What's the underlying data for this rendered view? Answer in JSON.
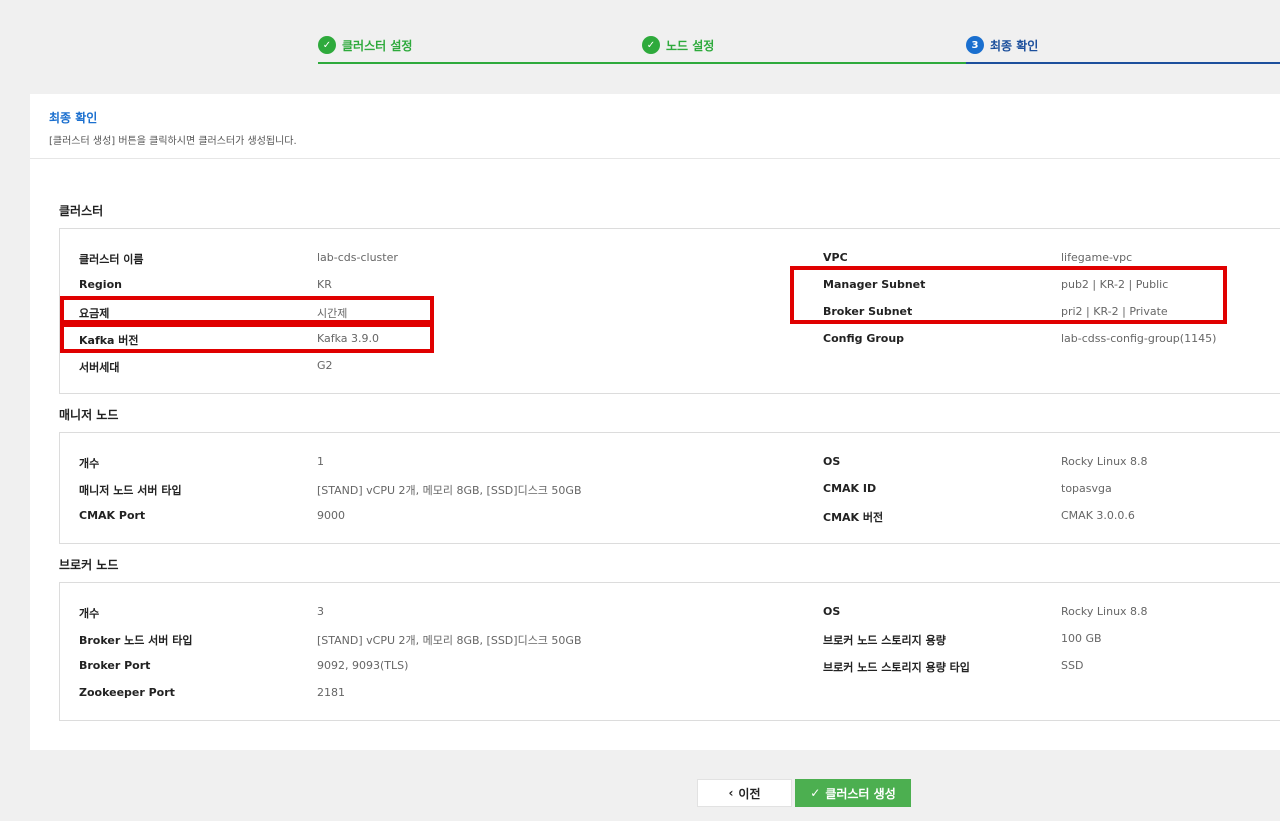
{
  "stepper": {
    "steps": [
      {
        "label": "클러스터 설정",
        "state": "done",
        "marker": "✓"
      },
      {
        "label": "노드 설정",
        "state": "done",
        "marker": "✓"
      },
      {
        "label": "최종 확인",
        "state": "current",
        "marker": "3"
      }
    ],
    "colors": {
      "done": "#2eaa3c",
      "current": "#1a6fcf"
    }
  },
  "card": {
    "title": "최종 확인",
    "description": "[클러스터 생성] 버튼을 클릭하시면 클러스터가 생성됩니다."
  },
  "sections": {
    "cluster": {
      "title": "클러스터",
      "left": [
        {
          "label": "클러스터 이름",
          "value": "lab-cds-cluster"
        },
        {
          "label": "Region",
          "value": "KR"
        },
        {
          "label": "요금제",
          "value": "시간제"
        },
        {
          "label": "Kafka 버전",
          "value": "Kafka 3.9.0"
        },
        {
          "label": "서버세대",
          "value": "G2"
        }
      ],
      "right": [
        {
          "label": "VPC",
          "value": "lifegame-vpc"
        },
        {
          "label": "Manager Subnet",
          "value": "pub2 | KR-2 | Public"
        },
        {
          "label": "Broker Subnet",
          "value": "pri2 | KR-2 | Private"
        },
        {
          "label": "Config Group",
          "value": "lab-cdss-config-group(1145)"
        }
      ]
    },
    "manager": {
      "title": "매니저 노드",
      "left": [
        {
          "label": "개수",
          "value": "1"
        },
        {
          "label": "매니저 노드 서버 타입",
          "value": "[STAND] vCPU 2개, 메모리 8GB, [SSD]디스크 50GB"
        },
        {
          "label": "CMAK Port",
          "value": "9000"
        }
      ],
      "right": [
        {
          "label": "OS",
          "value": "Rocky Linux 8.8"
        },
        {
          "label": "CMAK ID",
          "value": "topasvga"
        },
        {
          "label": "CMAK 버전",
          "value": "CMAK 3.0.0.6"
        }
      ]
    },
    "broker": {
      "title": "브로커 노드",
      "left": [
        {
          "label": "개수",
          "value": "3"
        },
        {
          "label": "Broker 노드 서버 타입",
          "value": "[STAND] vCPU 2개, 메모리 8GB, [SSD]디스크 50GB"
        },
        {
          "label": "Broker Port",
          "value": "9092, 9093(TLS)"
        },
        {
          "label": "Zookeeper Port",
          "value": "2181"
        }
      ],
      "right": [
        {
          "label": "OS",
          "value": "Rocky Linux 8.8"
        },
        {
          "label": "브로커 노드 스토리지 용량",
          "value": "100 GB"
        },
        {
          "label": "브로커 노드 스토리지 용량 타입",
          "value": "SSD"
        }
      ]
    }
  },
  "buttons": {
    "prev_label": "이전",
    "prev_icon": "chevron-left-icon",
    "create_label": "클러스터 생성",
    "create_icon": "check-icon",
    "create_color": "#4caf50"
  },
  "annotation_color": "#e00000"
}
